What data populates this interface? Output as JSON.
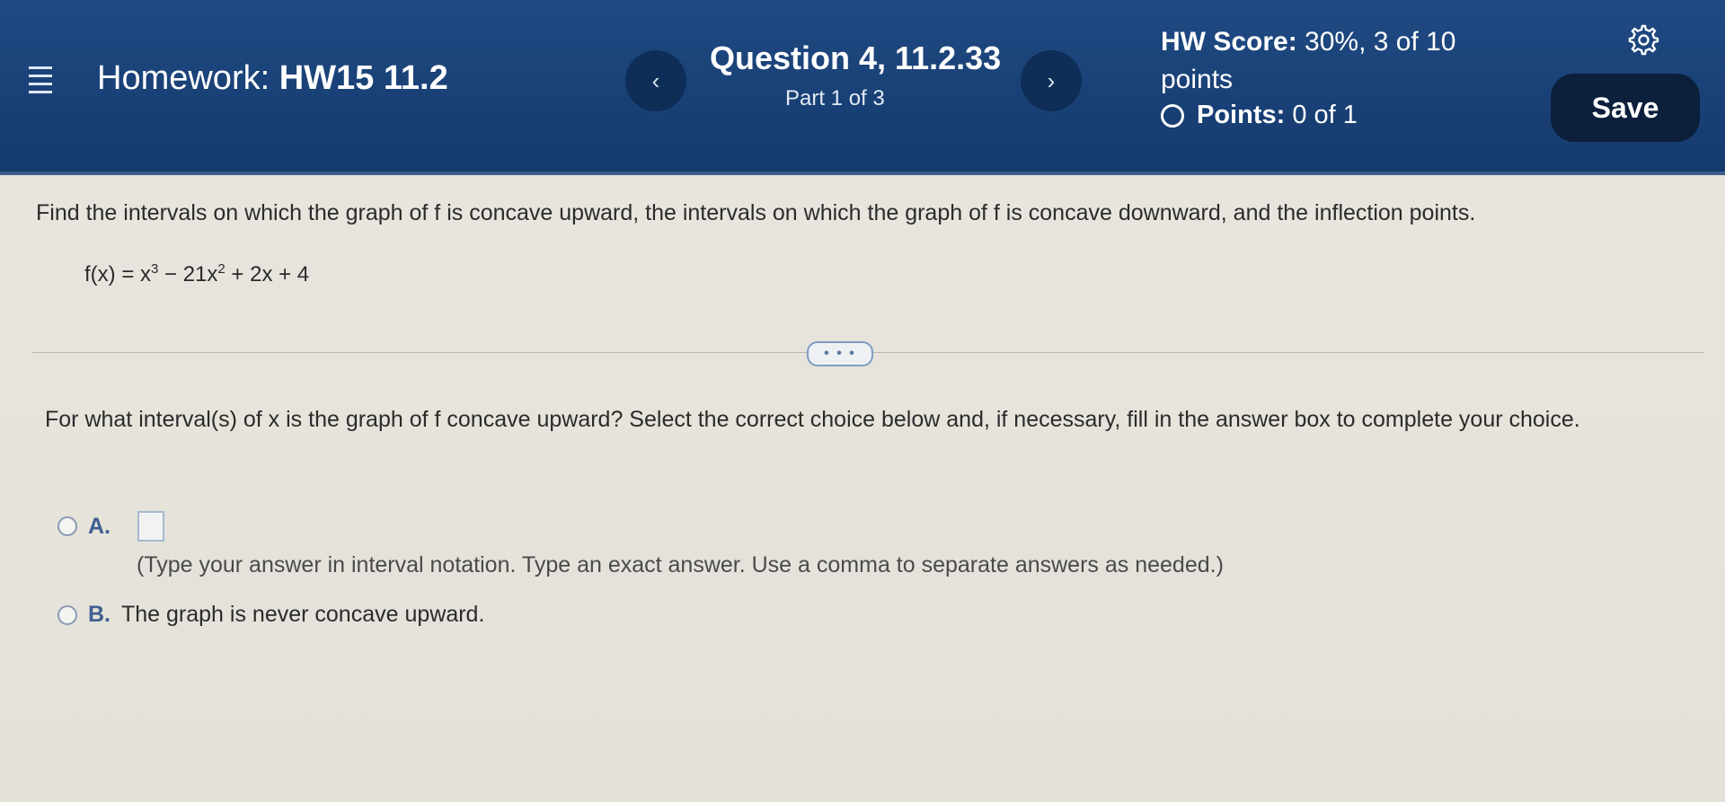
{
  "header": {
    "homework_label": "Homework:",
    "homework_name": "HW15 11.2",
    "prev_symbol": "‹",
    "next_symbol": "›",
    "question_title": "Question 4, 11.2.33",
    "question_part": "Part 1 of 3",
    "score_label": "HW Score:",
    "score_value": "30%, 3 of 10",
    "score_unit": "points",
    "points_label": "Points:",
    "points_value": "0 of 1",
    "save_label": "Save"
  },
  "problem": {
    "prompt": "Find the intervals on which the graph of f is concave upward, the intervals on which the graph of f is concave downward, and the inflection points.",
    "formula_lhs": "f(x) = x",
    "formula_exp1": "3",
    "formula_mid": " − 21x",
    "formula_exp2": "2",
    "formula_rhs": " + 2x + 4",
    "expand_label": "• • •"
  },
  "question": {
    "text": "For what interval(s) of x is the graph of f concave upward? Select the correct choice below and, if necessary, fill in the answer box to complete your choice.",
    "choice_a_letter": "A.",
    "choice_a_hint": "(Type your answer in interval notation. Type an exact answer. Use a comma to separate answers as needed.)",
    "choice_b_letter": "B.",
    "choice_b_text": "The graph is never concave upward."
  },
  "colors": {
    "header_bg": "#1f4a82",
    "save_bg": "#0c1f3b",
    "choice_letter": "#3f5f8f"
  }
}
